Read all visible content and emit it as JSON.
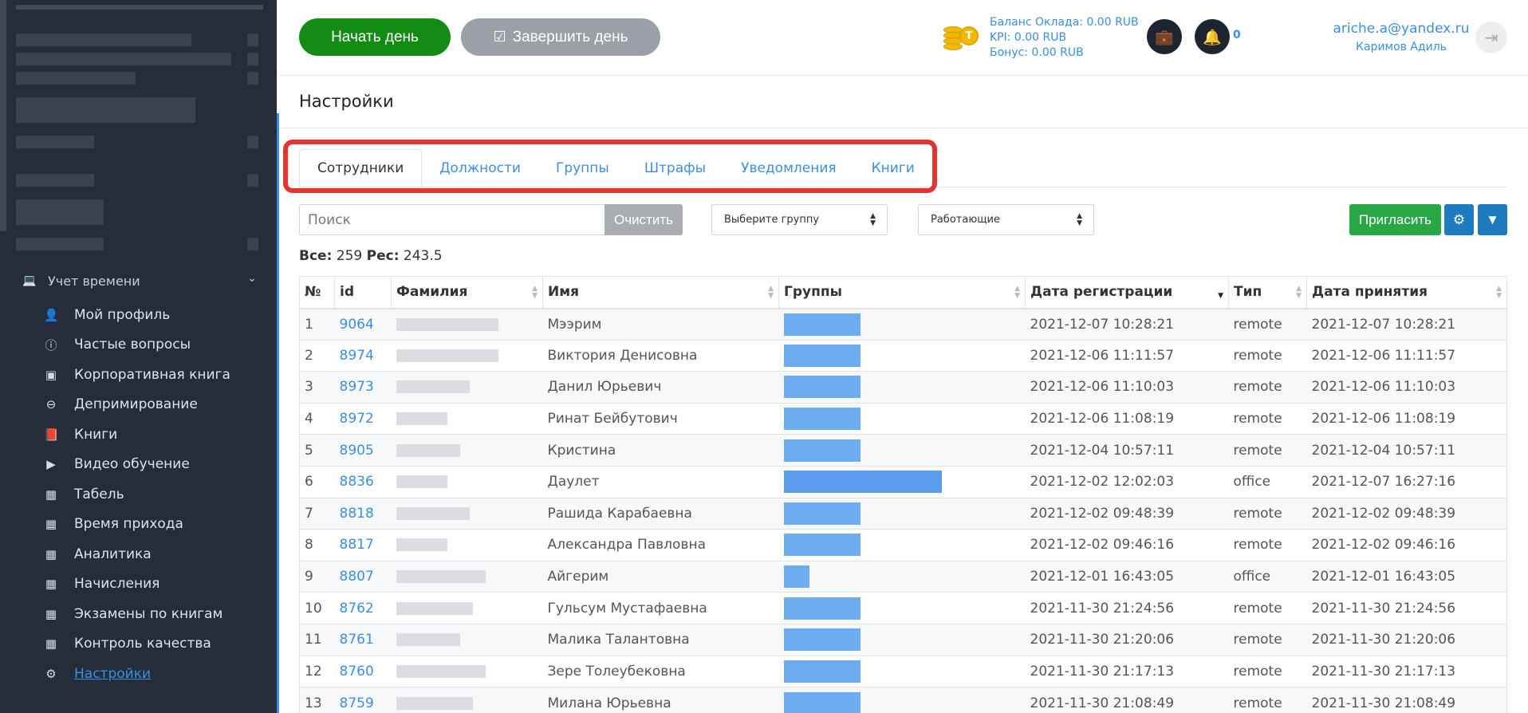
{
  "sidebar": {
    "section": {
      "label": "Учет времени",
      "icon": "laptop-icon"
    },
    "items": [
      {
        "label": "Мой профиль",
        "icon": "user-icon"
      },
      {
        "label": "Частые вопросы",
        "icon": "info-circle-icon"
      },
      {
        "label": "Корпоративная книга",
        "icon": "contact-book-icon"
      },
      {
        "label": "Депримирование",
        "icon": "minus-circle-icon"
      },
      {
        "label": "Книги",
        "icon": "book-icon"
      },
      {
        "label": "Видео обучение",
        "icon": "play-icon"
      },
      {
        "label": "Табель",
        "icon": "calendar-icon"
      },
      {
        "label": "Время прихода",
        "icon": "calendar-icon"
      },
      {
        "label": "Аналитика",
        "icon": "calendar-icon"
      },
      {
        "label": "Начисления",
        "icon": "calendar-icon"
      },
      {
        "label": "Экзамены по книгам",
        "icon": "calendar-icon"
      },
      {
        "label": "Контроль качества",
        "icon": "calendar-icon"
      },
      {
        "label": "Настройки",
        "icon": "gears-icon",
        "active": true
      }
    ]
  },
  "header": {
    "start_day": "Начать день",
    "end_day": "Завершить день",
    "balance_salary": "Баланс Оклада: 0.00 RUB",
    "balance_kpi": "KPI: 0.00 RUB",
    "balance_bonus": "Бонус: 0.00 RUB",
    "notifications_count": "0",
    "user_email": "ariche.a@yandex.ru",
    "user_name": "Каримов Адиль",
    "coin_letter": "T"
  },
  "page": {
    "title": "Настройки"
  },
  "tabs": [
    "Сотрудники",
    "Должности",
    "Группы",
    "Штрафы",
    "Уведомления",
    "Книги"
  ],
  "toolbar": {
    "search_placeholder": "Поиск",
    "clear_label": "Очистить",
    "group_select": "Выберите группу",
    "status_select": "Работающие",
    "invite_label": "Пригласить"
  },
  "stats": {
    "total_label": "Все:",
    "total_value": "259",
    "res_label": "Рес:",
    "res_value": "243.5"
  },
  "table": {
    "columns": [
      "№",
      "id",
      "Фамилия",
      "Имя",
      "Группы",
      "Дата регистрации",
      "Тип",
      "Дата принятия"
    ],
    "rows": [
      {
        "n": "1",
        "id": "9064",
        "name": "Мээрим",
        "reg": "2021-12-07 10:28:21",
        "type": "remote",
        "accepted": "2021-12-07 10:28:21"
      },
      {
        "n": "2",
        "id": "8974",
        "name": "Виктория Денисовна",
        "reg": "2021-12-06 11:11:57",
        "type": "remote",
        "accepted": "2021-12-06 11:11:57"
      },
      {
        "n": "3",
        "id": "8973",
        "name": "Данил Юрьевич",
        "reg": "2021-12-06 11:10:03",
        "type": "remote",
        "accepted": "2021-12-06 11:10:03"
      },
      {
        "n": "4",
        "id": "8972",
        "name": "Ринат Бейбутович",
        "reg": "2021-12-06 11:08:19",
        "type": "remote",
        "accepted": "2021-12-06 11:08:19"
      },
      {
        "n": "5",
        "id": "8905",
        "name": "Кристина",
        "reg": "2021-12-04 10:57:11",
        "type": "remote",
        "accepted": "2021-12-04 10:57:11"
      },
      {
        "n": "6",
        "id": "8836",
        "name": "Даулет",
        "reg": "2021-12-02 12:02:03",
        "type": "office",
        "accepted": "2021-12-07 16:27:16"
      },
      {
        "n": "7",
        "id": "8818",
        "name": "Рашида Карабаевна",
        "reg": "2021-12-02 09:48:39",
        "type": "remote",
        "accepted": "2021-12-02 09:48:39"
      },
      {
        "n": "8",
        "id": "8817",
        "name": "Александра Павловна",
        "reg": "2021-12-02 09:46:16",
        "type": "remote",
        "accepted": "2021-12-02 09:46:16"
      },
      {
        "n": "9",
        "id": "8807",
        "name": "Айгерим",
        "reg": "2021-12-01 16:43:05",
        "type": "office",
        "accepted": "2021-12-01 16:43:05"
      },
      {
        "n": "10",
        "id": "8762",
        "name": "Гульсум Мустафаевна",
        "reg": "2021-11-30 21:24:56",
        "type": "remote",
        "accepted": "2021-11-30 21:24:56"
      },
      {
        "n": "11",
        "id": "8761",
        "name": "Малика Талантовна",
        "reg": "2021-11-30 21:20:06",
        "type": "remote",
        "accepted": "2021-11-30 21:20:06"
      },
      {
        "n": "12",
        "id": "8760",
        "name": "Зере Толеубековна",
        "reg": "2021-11-30 21:17:13",
        "type": "remote",
        "accepted": "2021-11-30 21:17:13"
      },
      {
        "n": "13",
        "id": "8759",
        "name": "Милана Юрьевна",
        "reg": "2021-11-30 21:08:49",
        "type": "remote",
        "accepted": "2021-11-30 21:08:49"
      }
    ]
  }
}
